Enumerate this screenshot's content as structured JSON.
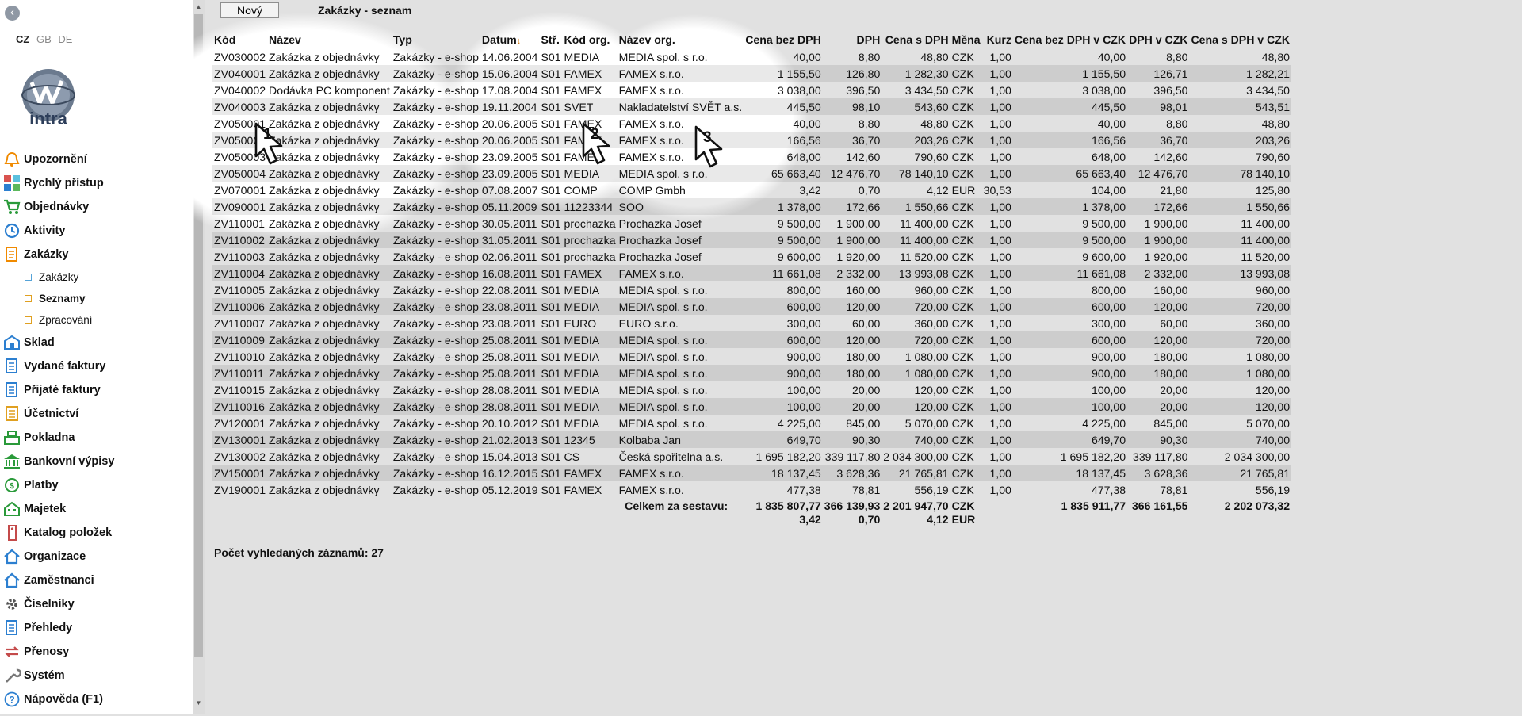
{
  "lang": [
    "CZ",
    "GB",
    "DE"
  ],
  "logo_text": "intra",
  "menu": [
    {
      "label": "Upozornění",
      "icon": "bell-icon",
      "color": "#f08a00"
    },
    {
      "label": "Rychlý přístup",
      "icon": "tiles-icon",
      "color": "#2c7fd0"
    },
    {
      "label": "Objednávky",
      "icon": "cart-icon",
      "color": "#2a9a3a"
    },
    {
      "label": "Aktivity",
      "icon": "clock-icon",
      "color": "#2c7fd0"
    },
    {
      "label": "Zakázky",
      "icon": "document-icon",
      "color": "#f08a00"
    },
    {
      "label": "Sklad",
      "icon": "warehouse-icon",
      "color": "#2c7fd0"
    },
    {
      "label": "Vydané faktury",
      "icon": "invoice-out-icon",
      "color": "#2c7fd0"
    },
    {
      "label": "Přijaté faktury",
      "icon": "invoice-in-icon",
      "color": "#2c7fd0"
    },
    {
      "label": "Účetnictví",
      "icon": "ledger-icon",
      "color": "#e0a020"
    },
    {
      "label": "Pokladna",
      "icon": "cash-register-icon",
      "color": "#2a9a3a"
    },
    {
      "label": "Bankovní výpisy",
      "icon": "bank-icon",
      "color": "#2a9a3a"
    },
    {
      "label": "Platby",
      "icon": "money-icon",
      "color": "#2a9a3a"
    },
    {
      "label": "Majetek",
      "icon": "building-icon",
      "color": "#2a9a3a"
    },
    {
      "label": "Katalog položek",
      "icon": "tag-icon",
      "color": "#c44a4a"
    },
    {
      "label": "Organizace",
      "icon": "house-icon",
      "color": "#2c7fd0"
    },
    {
      "label": "Zaměstnanci",
      "icon": "house-icon",
      "color": "#2c7fd0"
    },
    {
      "label": "Číselníky",
      "icon": "gear-icon",
      "color": "#555555"
    },
    {
      "label": "Přehledy",
      "icon": "list-icon",
      "color": "#2c7fd0"
    },
    {
      "label": "Přenosy",
      "icon": "transfer-icon",
      "color": "#c44a4a"
    },
    {
      "label": "Systém",
      "icon": "wrench-icon",
      "color": "#777777"
    },
    {
      "label": "Nápověda (F1)",
      "icon": "help-icon",
      "color": "#2c7fd0"
    }
  ],
  "submenu": [
    {
      "label": "Zakázky",
      "icon": "square-icon",
      "active": false
    },
    {
      "label": "Seznamy",
      "icon": "folder-icon",
      "active": true
    },
    {
      "label": "Zpracování",
      "icon": "folder-icon",
      "active": false
    }
  ],
  "toolbar": {
    "new_label": "Nový",
    "title": "Zakázky - seznam"
  },
  "table": {
    "columns": [
      {
        "label": "Kód",
        "align": "left"
      },
      {
        "label": "Název",
        "align": "left"
      },
      {
        "label": "Typ",
        "align": "left"
      },
      {
        "label": "Datum",
        "align": "left",
        "sort": "↓"
      },
      {
        "label": "Stř.",
        "align": "left"
      },
      {
        "label": "Kód org.",
        "align": "left"
      },
      {
        "label": "Název org.",
        "align": "left"
      },
      {
        "label": "Cena bez DPH",
        "align": "right"
      },
      {
        "label": "DPH",
        "align": "right"
      },
      {
        "label": "Cena s DPH",
        "align": "right"
      },
      {
        "label": "Měna",
        "align": "left"
      },
      {
        "label": "Kurz",
        "align": "right"
      },
      {
        "label": "Cena bez DPH v CZK",
        "align": "right"
      },
      {
        "label": "DPH v CZK",
        "align": "right"
      },
      {
        "label": "Cena s DPH v CZK",
        "align": "right"
      }
    ],
    "rows": [
      [
        "ZV030002",
        "Zakázka z objednávky",
        "Zakázky - e-shop",
        "14.06.2004",
        "S01",
        "MEDIA",
        "MEDIA spol. s r.o.",
        "40,00",
        "8,80",
        "48,80",
        "CZK",
        "1,00",
        "40,00",
        "8,80",
        "48,80"
      ],
      [
        "ZV040001",
        "Zakázka z objednávky",
        "Zakázky - e-shop",
        "15.06.2004",
        "S01",
        "FAMEX",
        "FAMEX s.r.o.",
        "1 155,50",
        "126,80",
        "1 282,30",
        "CZK",
        "1,00",
        "1 155,50",
        "126,71",
        "1 282,21"
      ],
      [
        "ZV040002",
        "Dodávka PC komponent",
        "Zakázky - e-shop",
        "17.08.2004",
        "S01",
        "FAMEX",
        "FAMEX s.r.o.",
        "3 038,00",
        "396,50",
        "3 434,50",
        "CZK",
        "1,00",
        "3 038,00",
        "396,50",
        "3 434,50"
      ],
      [
        "ZV040003",
        "Zakázka z objednávky",
        "Zakázky - e-shop",
        "19.11.2004",
        "S01",
        "SVET",
        "Nakladatelství SVĚT a.s.",
        "445,50",
        "98,10",
        "543,60",
        "CZK",
        "1,00",
        "445,50",
        "98,01",
        "543,51"
      ],
      [
        "ZV050001",
        "Zakázka z objednávky",
        "Zakázky - e-shop",
        "20.06.2005",
        "S01",
        "FAMEX",
        "FAMEX s.r.o.",
        "40,00",
        "8,80",
        "48,80",
        "CZK",
        "1,00",
        "40,00",
        "8,80",
        "48,80"
      ],
      [
        "ZV050002",
        "Zakázka z objednávky",
        "Zakázky - e-shop",
        "20.06.2005",
        "S01",
        "FAMEX",
        "FAMEX s.r.o.",
        "166,56",
        "36,70",
        "203,26",
        "CZK",
        "1,00",
        "166,56",
        "36,70",
        "203,26"
      ],
      [
        "ZV050003",
        "Zakázka z objednávky",
        "Zakázky - e-shop",
        "23.09.2005",
        "S01",
        "FAMEX",
        "FAMEX s.r.o.",
        "648,00",
        "142,60",
        "790,60",
        "CZK",
        "1,00",
        "648,00",
        "142,60",
        "790,60"
      ],
      [
        "ZV050004",
        "Zakázka z objednávky",
        "Zakázky - e-shop",
        "23.09.2005",
        "S01",
        "MEDIA",
        "MEDIA spol. s r.o.",
        "65 663,40",
        "12 476,70",
        "78 140,10",
        "CZK",
        "1,00",
        "65 663,40",
        "12 476,70",
        "78 140,10"
      ],
      [
        "ZV070001",
        "Zakázka z objednávky",
        "Zakázky - e-shop",
        "07.08.2007",
        "S01",
        "COMP",
        "COMP Gmbh",
        "3,42",
        "0,70",
        "4,12",
        "EUR",
        "30,53",
        "104,00",
        "21,80",
        "125,80"
      ],
      [
        "ZV090001",
        "Zakázka z objednávky",
        "Zakázky - e-shop",
        "05.11.2009",
        "S01",
        "11223344",
        "SOO",
        "1 378,00",
        "172,66",
        "1 550,66",
        "CZK",
        "1,00",
        "1 378,00",
        "172,66",
        "1 550,66"
      ],
      [
        "ZV110001",
        "Zakázka z objednávky",
        "Zakázky - e-shop",
        "30.05.2011",
        "S01",
        "prochazka",
        "Prochazka Josef",
        "9 500,00",
        "1 900,00",
        "11 400,00",
        "CZK",
        "1,00",
        "9 500,00",
        "1 900,00",
        "11 400,00"
      ],
      [
        "ZV110002",
        "Zakázka z objednávky",
        "Zakázky - e-shop",
        "31.05.2011",
        "S01",
        "prochazka",
        "Prochazka Josef",
        "9 500,00",
        "1 900,00",
        "11 400,00",
        "CZK",
        "1,00",
        "9 500,00",
        "1 900,00",
        "11 400,00"
      ],
      [
        "ZV110003",
        "Zakázka z objednávky",
        "Zakázky - e-shop",
        "02.06.2011",
        "S01",
        "prochazka",
        "Prochazka Josef",
        "9 600,00",
        "1 920,00",
        "11 520,00",
        "CZK",
        "1,00",
        "9 600,00",
        "1 920,00",
        "11 520,00"
      ],
      [
        "ZV110004",
        "Zakázka z objednávky",
        "Zakázky - e-shop",
        "16.08.2011",
        "S01",
        "FAMEX",
        "FAMEX s.r.o.",
        "11 661,08",
        "2 332,00",
        "13 993,08",
        "CZK",
        "1,00",
        "11 661,08",
        "2 332,00",
        "13 993,08"
      ],
      [
        "ZV110005",
        "Zakázka z objednávky",
        "Zakázky - e-shop",
        "22.08.2011",
        "S01",
        "MEDIA",
        "MEDIA spol. s r.o.",
        "800,00",
        "160,00",
        "960,00",
        "CZK",
        "1,00",
        "800,00",
        "160,00",
        "960,00"
      ],
      [
        "ZV110006",
        "Zakázka z objednávky",
        "Zakázky - e-shop",
        "23.08.2011",
        "S01",
        "MEDIA",
        "MEDIA spol. s r.o.",
        "600,00",
        "120,00",
        "720,00",
        "CZK",
        "1,00",
        "600,00",
        "120,00",
        "720,00"
      ],
      [
        "ZV110007",
        "Zakázka z objednávky",
        "Zakázky - e-shop",
        "23.08.2011",
        "S01",
        "EURO",
        "EURO s.r.o.",
        "300,00",
        "60,00",
        "360,00",
        "CZK",
        "1,00",
        "300,00",
        "60,00",
        "360,00"
      ],
      [
        "ZV110009",
        "Zakázka z objednávky",
        "Zakázky - e-shop",
        "25.08.2011",
        "S01",
        "MEDIA",
        "MEDIA spol. s r.o.",
        "600,00",
        "120,00",
        "720,00",
        "CZK",
        "1,00",
        "600,00",
        "120,00",
        "720,00"
      ],
      [
        "ZV110010",
        "Zakázka z objednávky",
        "Zakázky - e-shop",
        "25.08.2011",
        "S01",
        "MEDIA",
        "MEDIA spol. s r.o.",
        "900,00",
        "180,00",
        "1 080,00",
        "CZK",
        "1,00",
        "900,00",
        "180,00",
        "1 080,00"
      ],
      [
        "ZV110011",
        "Zakázka z objednávky",
        "Zakázky - e-shop",
        "25.08.2011",
        "S01",
        "MEDIA",
        "MEDIA spol. s r.o.",
        "900,00",
        "180,00",
        "1 080,00",
        "CZK",
        "1,00",
        "900,00",
        "180,00",
        "1 080,00"
      ],
      [
        "ZV110015",
        "Zakázka z objednávky",
        "Zakázky - e-shop",
        "28.08.2011",
        "S01",
        "MEDIA",
        "MEDIA spol. s r.o.",
        "100,00",
        "20,00",
        "120,00",
        "CZK",
        "1,00",
        "100,00",
        "20,00",
        "120,00"
      ],
      [
        "ZV110016",
        "Zakázka z objednávky",
        "Zakázky - e-shop",
        "28.08.2011",
        "S01",
        "MEDIA",
        "MEDIA spol. s r.o.",
        "100,00",
        "20,00",
        "120,00",
        "CZK",
        "1,00",
        "100,00",
        "20,00",
        "120,00"
      ],
      [
        "ZV120001",
        "Zakázka z objednávky",
        "Zakázky - e-shop",
        "20.10.2012",
        "S01",
        "MEDIA",
        "MEDIA spol. s r.o.",
        "4 225,00",
        "845,00",
        "5 070,00",
        "CZK",
        "1,00",
        "4 225,00",
        "845,00",
        "5 070,00"
      ],
      [
        "ZV130001",
        "Zakázka z objednávky",
        "Zakázky - e-shop",
        "21.02.2013",
        "S01",
        "12345",
        "Kolbaba Jan",
        "649,70",
        "90,30",
        "740,00",
        "CZK",
        "1,00",
        "649,70",
        "90,30",
        "740,00"
      ],
      [
        "ZV130002",
        "Zakázka z objednávky",
        "Zakázky - e-shop",
        "15.04.2013",
        "S01",
        "CS",
        "Česká spořitelna a.s.",
        "1 695 182,20",
        "339 117,80",
        "2 034 300,00",
        "CZK",
        "1,00",
        "1 695 182,20",
        "339 117,80",
        "2 034 300,00"
      ],
      [
        "ZV150001",
        "Zakázka z objednávky",
        "Zakázky - e-shop",
        "16.12.2015",
        "S01",
        "FAMEX",
        "FAMEX s.r.o.",
        "18 137,45",
        "3 628,36",
        "21 765,81",
        "CZK",
        "1,00",
        "18 137,45",
        "3 628,36",
        "21 765,81"
      ],
      [
        "ZV190001",
        "Zakázka z objednávky",
        "Zakázky - e-shop",
        "05.12.2019",
        "S01",
        "FAMEX",
        "FAMEX s.r.o.",
        "477,38",
        "78,81",
        "556,19",
        "CZK",
        "1,00",
        "477,38",
        "78,81",
        "556,19"
      ]
    ],
    "total": {
      "label": "Celkem za sestavu:",
      "cena_bez_dph": [
        "1 835 807,77",
        "3,42"
      ],
      "dph": [
        "366 139,93",
        "0,70"
      ],
      "cena_s_dph": [
        "2 201 947,70",
        "4,12"
      ],
      "mena": [
        "CZK",
        "EUR"
      ],
      "cena_bez_dph_czk": "1 835 911,77",
      "dph_czk": "366 161,55",
      "cena_s_dph_czk": "2 202 073,32"
    }
  },
  "count_line": "Počet vyhledaných záznamů: 27",
  "cursors": [
    "1",
    "2",
    "3"
  ]
}
